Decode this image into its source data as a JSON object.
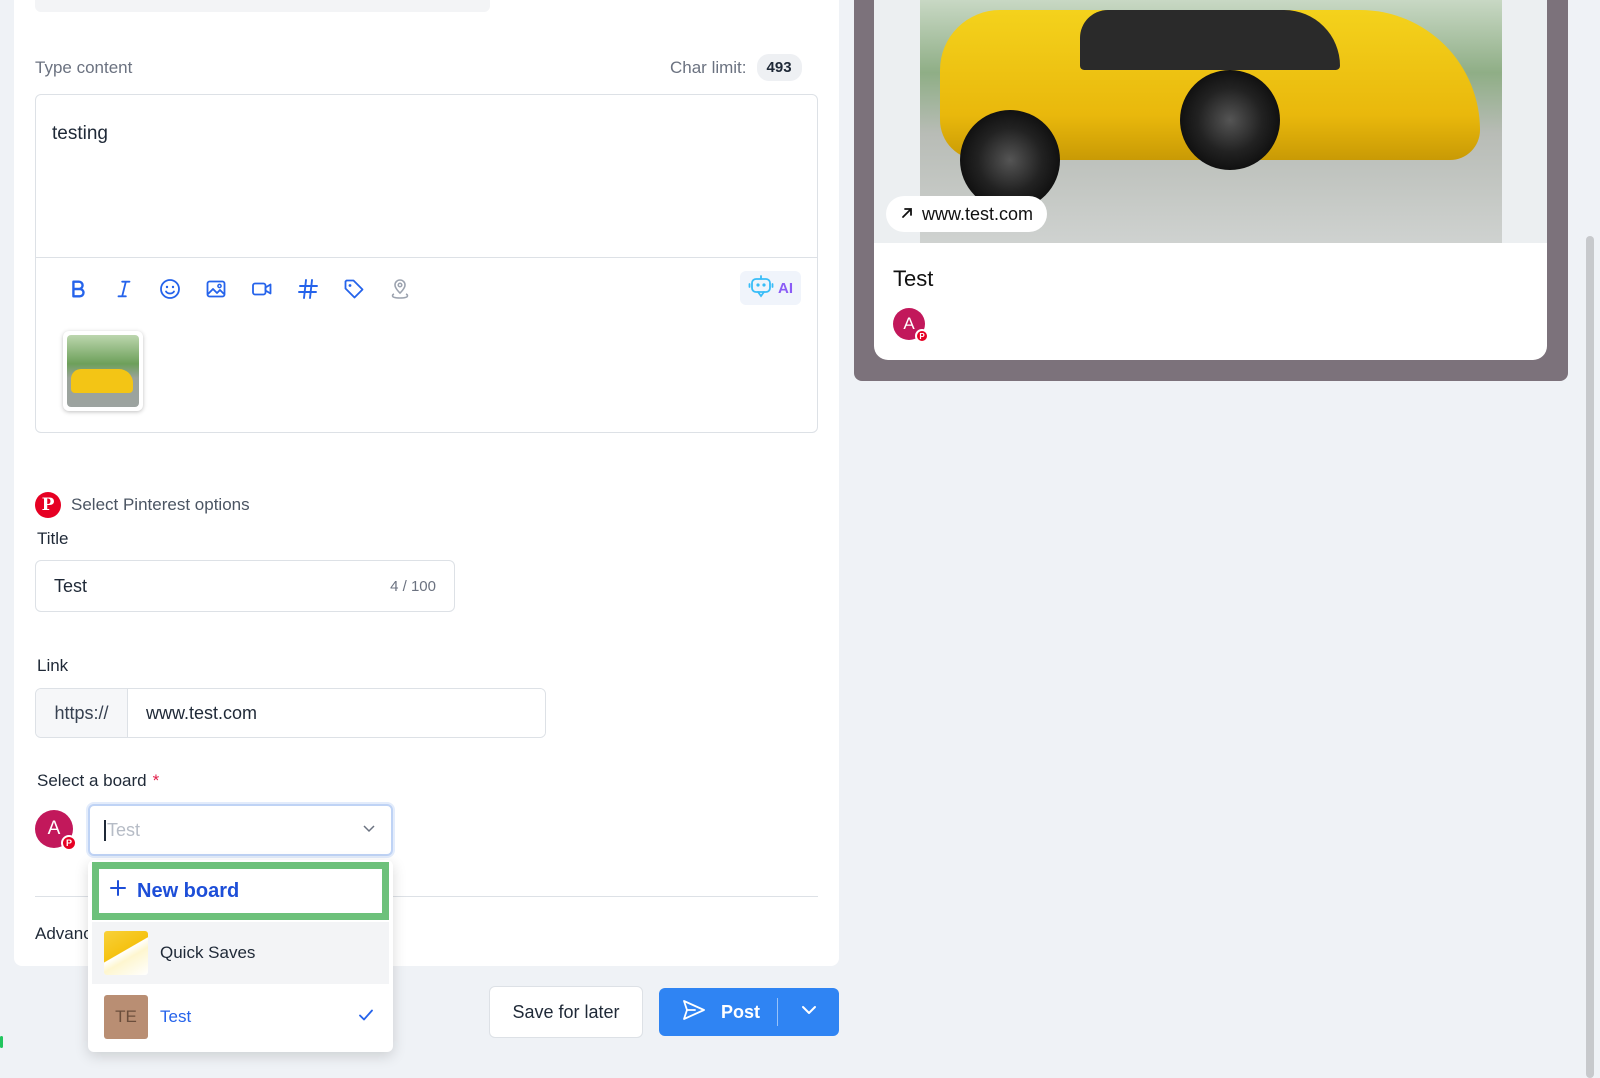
{
  "composer": {
    "content_label": "Type content",
    "char_limit_label": "Char limit:",
    "char_limit_value": "493",
    "content_text": "testing",
    "ai_label": "AI"
  },
  "toolbar_icons": [
    "bold-icon",
    "italic-icon",
    "emoji-icon",
    "image-icon",
    "video-icon",
    "hashtag-icon",
    "tag-icon",
    "location-icon"
  ],
  "pinterest": {
    "section_label": "Select Pinterest options",
    "title_label": "Title",
    "title_value": "Test",
    "title_counter": "4 / 100",
    "link_label": "Link",
    "link_prefix": "https://",
    "link_value": "www.test.com",
    "board_label": "Select a board",
    "board_required": "*",
    "board_placeholder": "Test",
    "account_initial": "A"
  },
  "dropdown": {
    "new_board_label": "New board",
    "items": [
      {
        "label": "Quick Saves",
        "icon": "quick-saves-thumb"
      },
      {
        "label": "Test",
        "initials": "TE",
        "selected": true
      }
    ]
  },
  "advanced_label": "Advanced",
  "actions": {
    "save_label": "Save for later",
    "post_label": "Post"
  },
  "preview": {
    "url": "www.test.com",
    "title": "Test",
    "account_initial": "A"
  },
  "colors": {
    "primary": "#2f84f3",
    "pinterest": "#e60023",
    "highlight": "#6dc17b",
    "avatar": "#c2185b"
  }
}
